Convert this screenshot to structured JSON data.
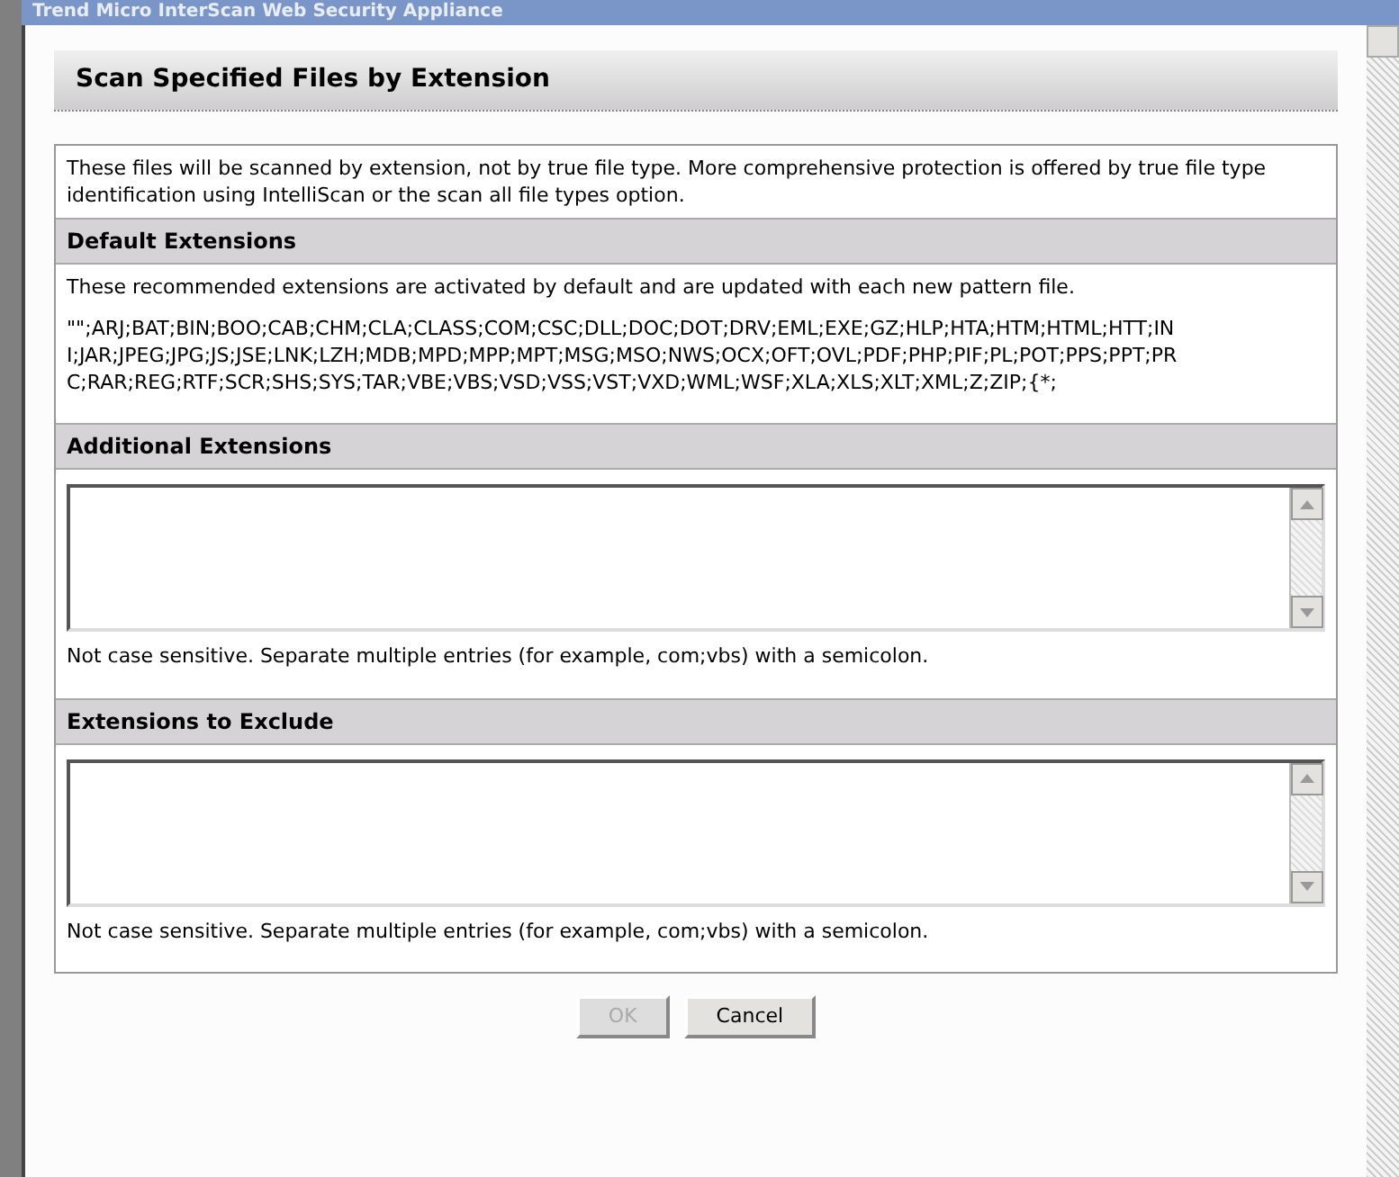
{
  "window": {
    "title": "Trend Micro InterScan Web  Security Appliance"
  },
  "dialog": {
    "title": "Scan Specified Files by Extension",
    "intro": "These files will be scanned by extension, not by true file type. More comprehensive protection is offered by true file type identification using IntelliScan or the scan all file types option.",
    "sections": [
      {
        "kind": "list",
        "heading": "Default Extensions",
        "description": "These recommended extensions are activated by default and are updated with each new pattern file.",
        "extensions": "\"\";ARJ;BAT;BIN;BOO;CAB;CHM;CLA;CLASS;COM;CSC;DLL;DOC;DOT;DRV;EML;EXE;GZ;HLP;HTA;HTM;HTML;HTT;INI;JAR;JPEG;JPG;JS;JSE;LNK;LZH;MDB;MPD;MPP;MPT;MSG;MSO;NWS;OCX;OFT;OVL;PDF;PHP;PIF;PL;POT;PPS;PPT;PRC;RAR;REG;RTF;SCR;SHS;SYS;TAR;VBE;VBS;VSD;VSS;VST;VXD;WML;WSF;XLA;XLS;XLT;XML;Z;ZIP;{*;"
      },
      {
        "kind": "input",
        "heading": "Additional Extensions",
        "hint": "Not case sensitive. Separate multiple entries (for example, com;vbs) with a semicolon."
      },
      {
        "kind": "input",
        "heading": "Extensions to Exclude",
        "hint": "Not case sensitive. Separate multiple entries (for example, com;vbs) with a semicolon."
      }
    ],
    "buttons": [
      {
        "label": "OK",
        "disabled": true
      },
      {
        "label": "Cancel",
        "disabled": false
      }
    ]
  }
}
